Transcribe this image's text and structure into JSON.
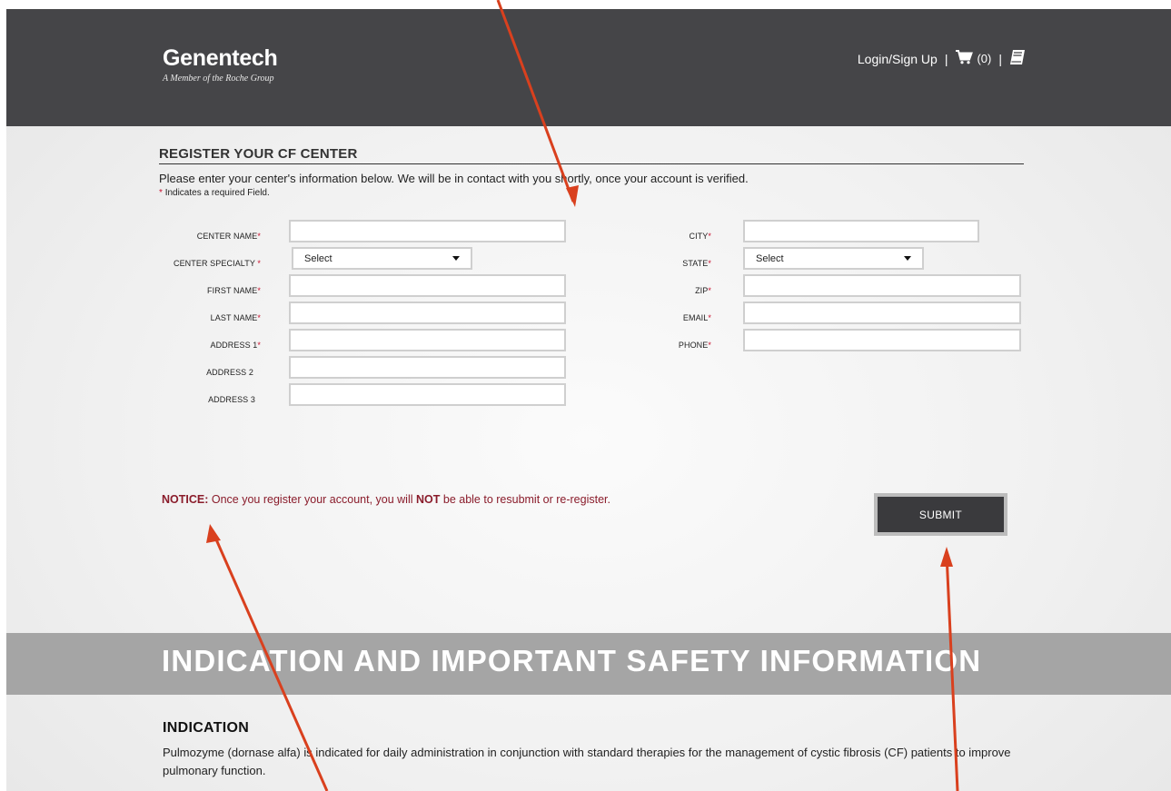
{
  "header": {
    "brand": "Genentech",
    "tagline": "A Member of the Roche Group",
    "login_label": "Login/Sign Up",
    "separator": "|",
    "cart_count": "(0)"
  },
  "form": {
    "title": "REGISTER YOUR CF CENTER",
    "intro": "Please enter your center's information below. We will be in contact with you shortly, once your account is verified.",
    "required_note": "Indicates a required Field.",
    "required_marker": "*",
    "left_fields": [
      {
        "label": "CENTER NAME",
        "required": "*",
        "value": ""
      },
      {
        "label": "CENTER SPECIALTY",
        "required": "*",
        "select": "Select"
      },
      {
        "label": "FIRST NAME",
        "required": "*",
        "value": ""
      },
      {
        "label": "LAST NAME",
        "required": "*",
        "value": ""
      },
      {
        "label": "ADDRESS 1",
        "required": "*",
        "value": ""
      },
      {
        "label": "ADDRESS 2",
        "required": "",
        "value": ""
      },
      {
        "label": "ADDRESS 3",
        "required": "",
        "value": ""
      }
    ],
    "right_fields": [
      {
        "label": "CITY",
        "required": "*",
        "value": ""
      },
      {
        "label": "STATE",
        "required": "*",
        "select": "Select"
      },
      {
        "label": "ZIP",
        "required": "*",
        "value": ""
      },
      {
        "label": "EMAIL",
        "required": "*",
        "value": ""
      },
      {
        "label": "PHONE",
        "required": "*",
        "value": ""
      }
    ],
    "notice_label": "NOTICE:",
    "notice_text_1": "Once you register your account, you will",
    "notice_not": "NOT",
    "notice_text_2": "be able to resubmit or re-register.",
    "submit_label": "SUBMIT"
  },
  "isi": {
    "title": "INDICATION AND IMPORTANT SAFETY INFORMATION",
    "indication_heading": "INDICATION",
    "indication_text": "Pulmozyme (dornase alfa) is indicated for daily administration in conjunction with standard therapies for the management of cystic fibrosis (CF) patients to improve pulmonary function."
  },
  "colors": {
    "header_bg": "#454548",
    "required": "#c8102e",
    "notice": "#8a1c2b",
    "submit_bg": "#3a3a3d",
    "isi_band": "#a5a5a5",
    "annotation_arrow": "#d9401e"
  },
  "icons": {
    "cart": "cart-icon",
    "book": "book-icon"
  }
}
